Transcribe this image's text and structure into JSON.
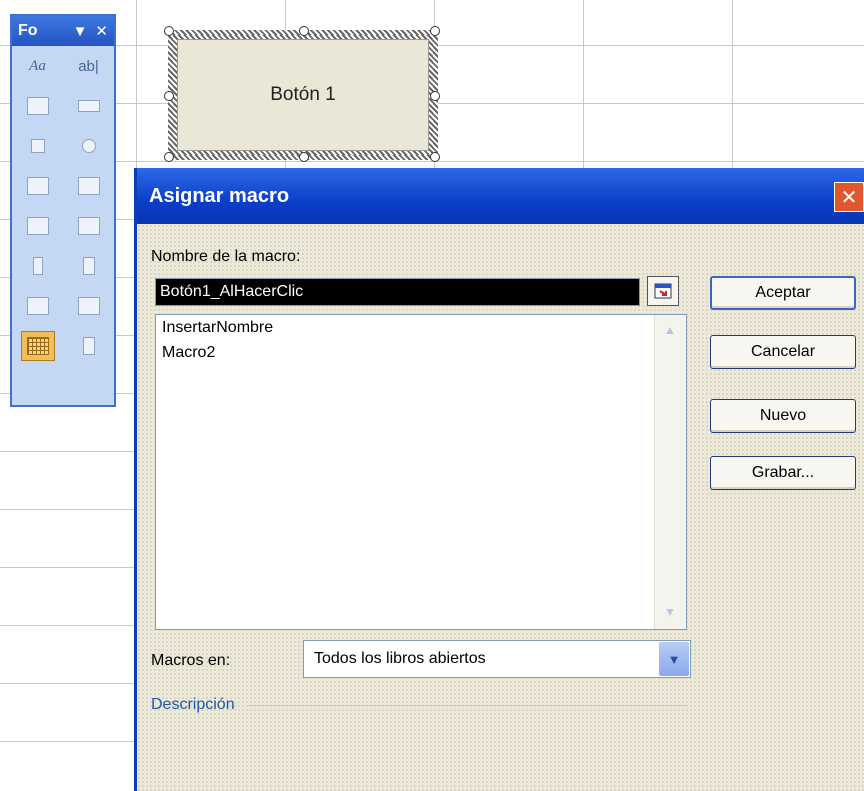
{
  "toolbar": {
    "title": "Fo",
    "dropdown_glyph": "▼",
    "close_glyph": "✕",
    "tools_row1": [
      "Aa",
      "ab|"
    ]
  },
  "sheet_button": {
    "label": "Botón 1"
  },
  "dialog": {
    "title": "Asignar macro",
    "close_glyph": "✕",
    "macro_name_label": "Nombre de la macro:",
    "macro_name_value": "Botón1_AlHacerClic",
    "macro_list": [
      "InsertarNombre",
      "Macro2"
    ],
    "buttons": {
      "ok": "Aceptar",
      "cancel": "Cancelar",
      "new": "Nuevo",
      "record": "Grabar..."
    },
    "macros_in_label": "Macros en:",
    "macros_in_value": "Todos los libros abiertos",
    "description_label": "Descripción"
  },
  "colors": {
    "titlebar": "#0a3fc8",
    "close": "#e1572d",
    "dialog_bg": "#ece9d8",
    "selection": "#000000"
  }
}
